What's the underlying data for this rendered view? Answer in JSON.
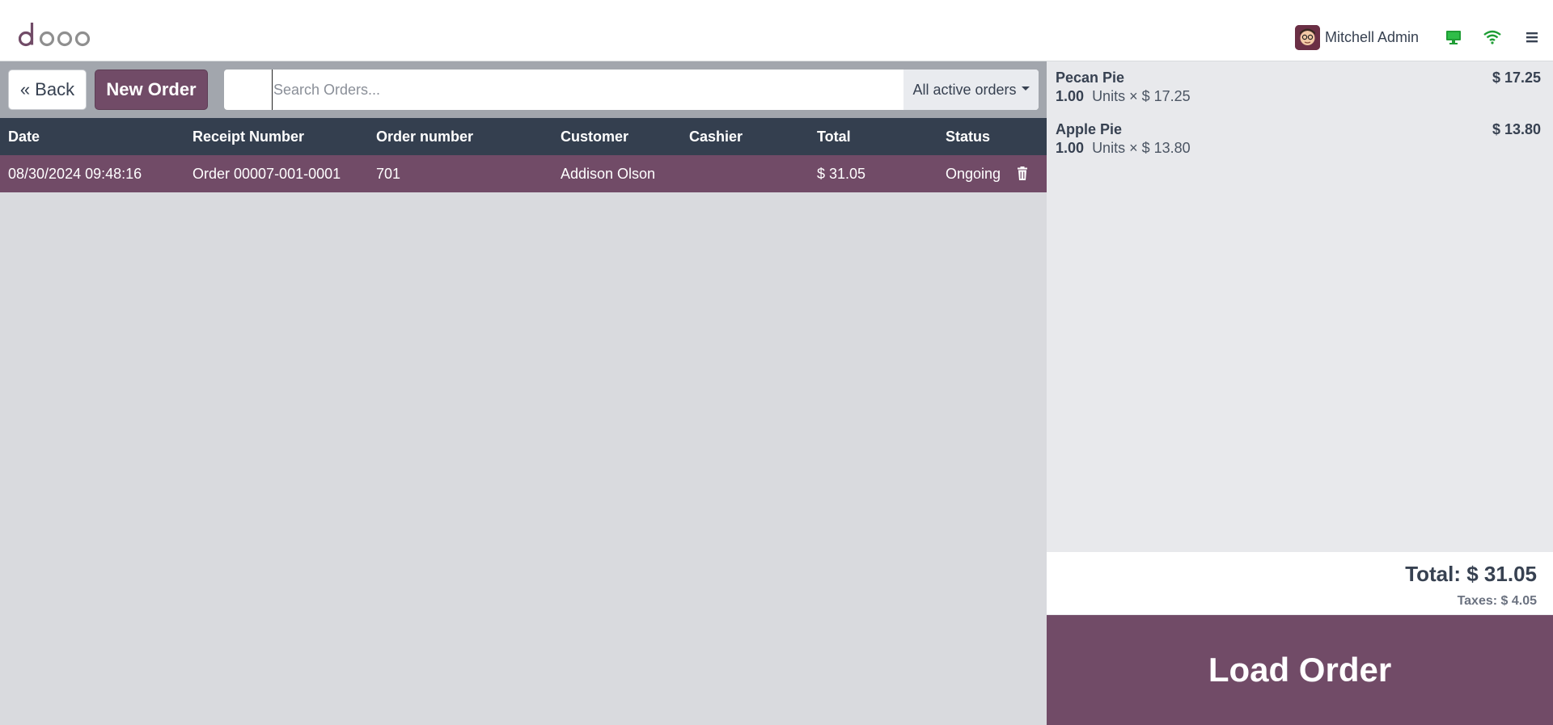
{
  "header": {
    "user_name": "Mitchell Admin",
    "icons": [
      "odoo-logo",
      "avatar",
      "monitor-icon",
      "wifi-icon",
      "menu-icon"
    ],
    "status_color": "#1f9d35"
  },
  "controls": {
    "back_label": "Back",
    "new_order_label": "New Order",
    "search_placeholder": "Search Orders...",
    "filter_label": "All active orders"
  },
  "table": {
    "columns": [
      "Date",
      "Receipt Number",
      "Order number",
      "Customer",
      "Cashier",
      "Total",
      "Status"
    ],
    "rows": [
      {
        "date": "08/30/2024 09:48:16",
        "receipt": "Order 00007-001-0001",
        "order_number": "701",
        "customer": "Addison Olson",
        "cashier": "",
        "total": "$ 31.05",
        "status": "Ongoing"
      }
    ]
  },
  "order_lines": [
    {
      "name": "Pecan Pie",
      "price": "$ 17.25",
      "qty": "1.00",
      "detail": "Units × $ 17.25"
    },
    {
      "name": "Apple Pie",
      "price": "$ 13.80",
      "qty": "1.00",
      "detail": "Units × $ 13.80"
    }
  ],
  "totals": {
    "total": "Total: $ 31.05",
    "taxes": "Taxes: $ 4.05"
  },
  "load_order_label": "Load Order",
  "colors": {
    "brand": "#714b67",
    "table_header": "#343f4f",
    "panel_bg": "#e8e9ec"
  }
}
